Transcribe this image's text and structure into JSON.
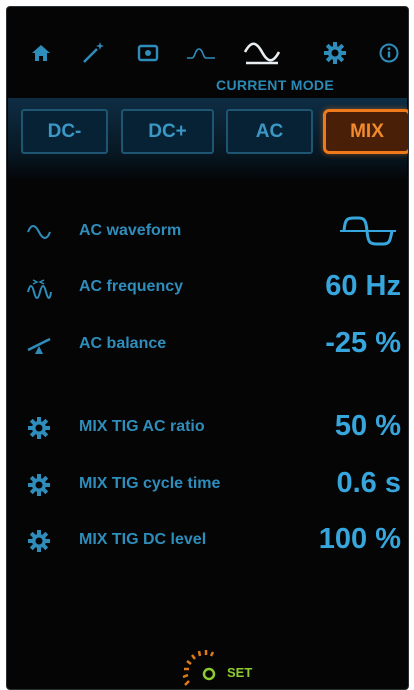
{
  "nav": {
    "items": [
      {
        "icon": "home-icon"
      },
      {
        "icon": "magic-wand-icon"
      },
      {
        "icon": "screen-icon"
      },
      {
        "icon": "pulse-curve-icon"
      },
      {
        "icon": "ac-wave-icon",
        "active": true
      },
      {
        "icon": "gear-icon"
      },
      {
        "icon": "info-icon"
      }
    ]
  },
  "header": {
    "title": "CURRENT MODE"
  },
  "modes": {
    "options": [
      "DC-",
      "DC+",
      "AC",
      "MIX"
    ],
    "selected": "MIX"
  },
  "params": [
    {
      "icon": "sine-wave-icon",
      "label": "AC waveform",
      "value": "",
      "value_icon": "square-ac-waveform-icon"
    },
    {
      "icon": "frequency-icon",
      "label": "AC frequency",
      "value": "60 Hz"
    },
    {
      "icon": "balance-icon",
      "label": "AC balance",
      "value": "-25 %"
    },
    {
      "icon": "gear-icon",
      "label": "MIX TIG AC ratio",
      "value": "50 %"
    },
    {
      "icon": "gear-icon",
      "label": "MIX TIG cycle time",
      "value": "0.6 s"
    },
    {
      "icon": "gear-icon",
      "label": "MIX TIG DC level",
      "value": "100 %"
    }
  ],
  "footer": {
    "set_label": "SET"
  },
  "colors": {
    "accent_blue": "#37a6dd",
    "label_blue": "#2f8dbb",
    "active_orange": "#ef7a1c",
    "set_green": "#8ccc2e",
    "background": "#050506"
  }
}
